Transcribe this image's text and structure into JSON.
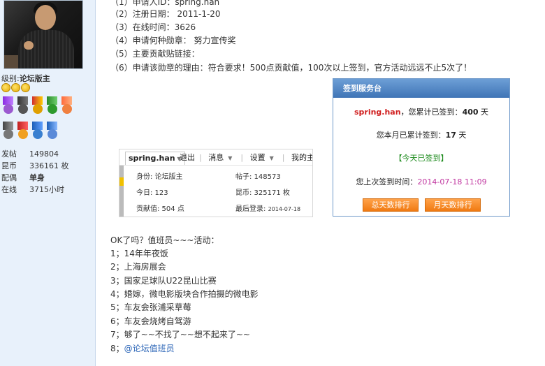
{
  "sidebar": {
    "level_label": "级别:",
    "level_value": "论坛版主",
    "stats": [
      {
        "key": "发帖",
        "value": "149804"
      },
      {
        "key": "昆币",
        "value": "336161 枚"
      },
      {
        "key": "配偶",
        "value": "单身"
      },
      {
        "key": "在线",
        "value": "3715小时"
      }
    ]
  },
  "post": {
    "app_lines": [
      "（1）申请人ID：spring.han",
      "（2）注册日期： 2011-1-20",
      "（3）在线时间：3626",
      "（4）申请何种勋章： 努力宣传奖",
      "（5）主要贡献贴链接：",
      "（6）申请该勋章的理由：符合要求！500点贡献值，100次以上签到，官方活动远远不止5次了！"
    ],
    "ok_line": "OK了吗？值班员~~~活动：",
    "activities": [
      "1；14年年夜饭",
      "2；上海房展会",
      "3；国家足球队U22昆山比赛",
      "4；婚嫁，微电影版块合作拍摄的微电影",
      "5；车友会张浦采草莓",
      "6；车友会烧烤自驾游",
      "7；够了~~不找了~~想不起来了~~"
    ],
    "last_prefix": "8；",
    "last_link": "@论坛值班员"
  },
  "profile_card": {
    "username": "spring.han",
    "nav": [
      "退出",
      "消息",
      "设置",
      "我的主题",
      "我"
    ],
    "identity": "身份: 论坛版主",
    "posts": "帖子: 148573",
    "today": "今日: 123",
    "coins": "昆币: 325171 枚",
    "contribution": "贡献值: 504 点",
    "last_login": "最后登录:",
    "last_login_date": "2014-07-18"
  },
  "sign_panel": {
    "title": "签到服务台",
    "user": "spring.han",
    "total_prefix": "，您累计已签到：",
    "total_days": "400",
    "total_suffix": "天",
    "month_line": "您本月已累计签到：",
    "month_days": "17",
    "month_suffix": "天",
    "today_status": "【今天已签到】",
    "last_prefix": "您上次签到时间：",
    "last_time": "2014-07-18 11:09",
    "btn_total": "总天数排行",
    "btn_month": "月天数排行"
  }
}
